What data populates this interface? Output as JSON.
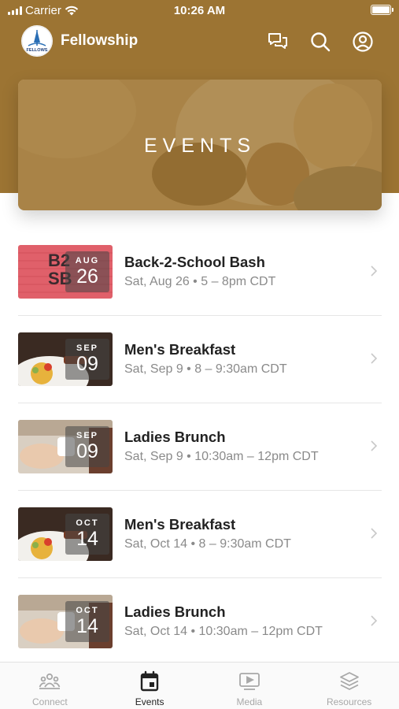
{
  "status_bar": {
    "carrier": "Carrier",
    "time": "10:26 AM"
  },
  "app_bar": {
    "title": "Fellowship",
    "logo_text": "FELLOWS",
    "icons": [
      "chat-icon",
      "search-icon",
      "profile-icon"
    ]
  },
  "hero": {
    "title": "EVENTS"
  },
  "events": [
    {
      "title": "Back-2-School Bash",
      "meta": "Sat, Aug 26 • 5 – 8pm CDT",
      "month": "AUG",
      "day": "26",
      "thumb": "b2s",
      "thumb_text": [
        "B2",
        "SB"
      ]
    },
    {
      "title": "Men's Breakfast",
      "meta": "Sat, Sep 9 • 8 – 9:30am CDT",
      "month": "SEP",
      "day": "09",
      "thumb": "breakfast"
    },
    {
      "title": "Ladies Brunch",
      "meta": "Sat, Sep 9 • 10:30am – 12pm CDT",
      "month": "SEP",
      "day": "09",
      "thumb": "brunch"
    },
    {
      "title": "Men's Breakfast",
      "meta": "Sat, Oct 14 • 8 – 9:30am CDT",
      "month": "OCT",
      "day": "14",
      "thumb": "breakfast"
    },
    {
      "title": "Ladies Brunch",
      "meta": "Sat, Oct 14 • 10:30am – 12pm CDT",
      "month": "OCT",
      "day": "14",
      "thumb": "brunch"
    }
  ],
  "tabs": [
    {
      "label": "Connect",
      "icon": "people-icon",
      "active": false
    },
    {
      "label": "Events",
      "icon": "calendar-icon",
      "active": true
    },
    {
      "label": "Media",
      "icon": "play-screen-icon",
      "active": false
    },
    {
      "label": "Resources",
      "icon": "layers-icon",
      "active": false
    }
  ],
  "colors": {
    "brand": "#9c7433",
    "text": "#222222",
    "muted": "#8a8a8a",
    "b2s_pink": "#e0606a"
  }
}
